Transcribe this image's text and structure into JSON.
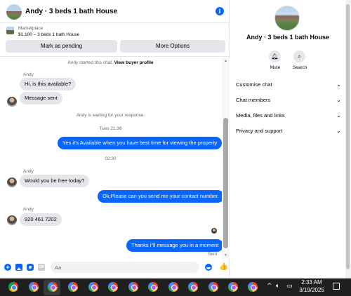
{
  "header": {
    "title": "Andy · 3 beds 1 bath House",
    "info_icon": "info-icon"
  },
  "listing": {
    "category": "Marketplace",
    "price_title": "$1,100 – 3 beds 1 bath House",
    "pending_label": "Mark as pending",
    "more_label": "More Options"
  },
  "messages": {
    "started_prefix": "Andy started this chat.",
    "view_profile_link": "View buyer profile",
    "sender_1": "Andy",
    "msg_1": "Hi, is this available?",
    "msg_2": "Message sent",
    "waiting_text": "Andy is waiting for your response.",
    "time_1": "Tues 21:36",
    "msg_3": "Yes it's Available when you have best time for viewing the property",
    "time_2": "02:30",
    "sender_2": "Andy",
    "msg_4": "Would you be free today?",
    "msg_5": "Ok,Please can you send me your contact number.",
    "sender_3": "Andy",
    "msg_6": "920 461 7202",
    "msg_7": "Thanks i\"ll message you in a moment",
    "status": "Sent"
  },
  "composer": {
    "placeholder": "Aa"
  },
  "info_panel": {
    "name": "Andy · 3 beds 1 bath House",
    "mute_label": "Mute",
    "search_label": "Search",
    "rows": [
      "Customise chat",
      "Chat members",
      "Media, files and links",
      "Privacy and support"
    ]
  },
  "taskbar": {
    "time": "2:33 AM",
    "date": "3/19/2025"
  },
  "colors": {
    "accent": "#0866ff",
    "incoming_bubble": "#e4e6eb",
    "taskbar": "#1f1f1f"
  }
}
